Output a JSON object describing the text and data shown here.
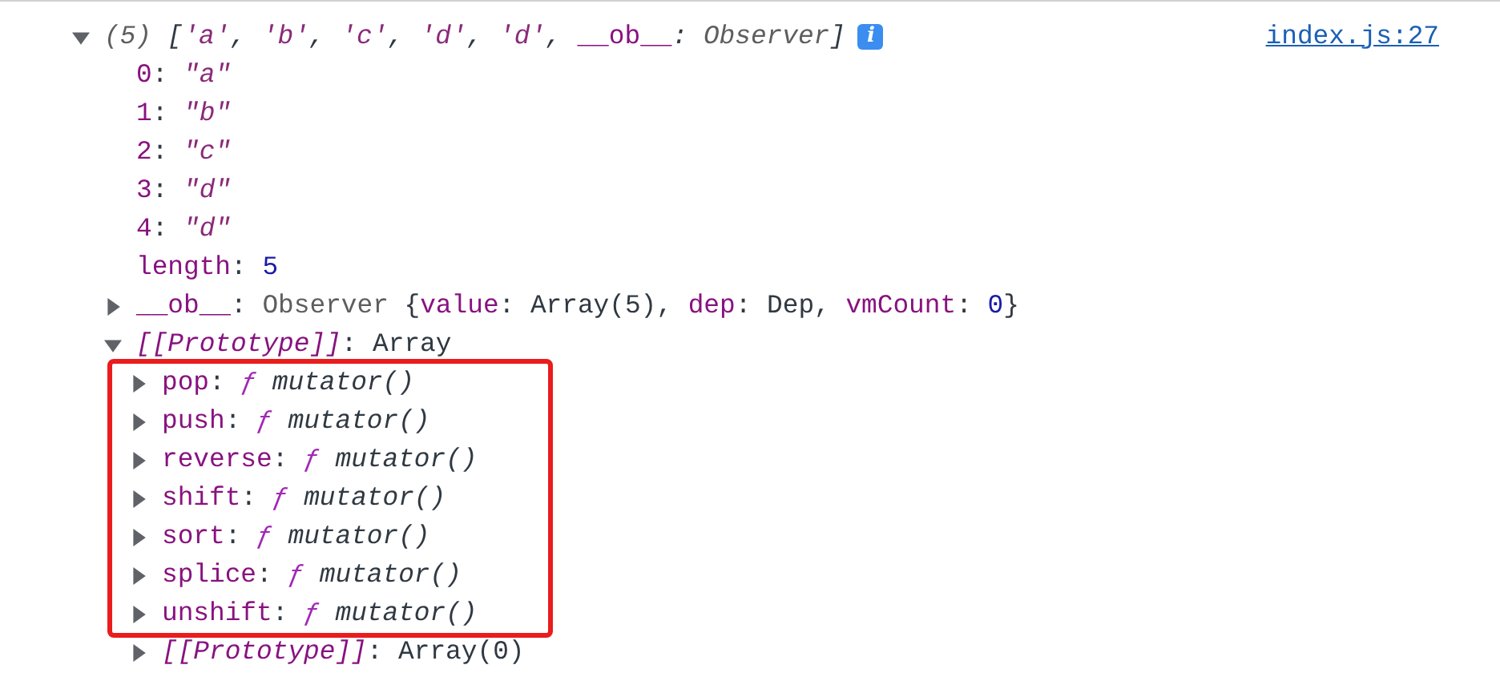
{
  "console": {
    "source_link": "index.js:27",
    "info_badge": "i",
    "summary": {
      "expanded": true,
      "tokens": [
        {
          "text": "(5) ",
          "kind": "meta"
        },
        {
          "text": "[",
          "kind": "punct"
        },
        {
          "text": "'a'",
          "kind": "string"
        },
        {
          "text": ", ",
          "kind": "punct"
        },
        {
          "text": "'b'",
          "kind": "string"
        },
        {
          "text": ", ",
          "kind": "punct"
        },
        {
          "text": "'c'",
          "kind": "string"
        },
        {
          "text": ", ",
          "kind": "punct"
        },
        {
          "text": "'d'",
          "kind": "string"
        },
        {
          "text": ", ",
          "kind": "punct"
        },
        {
          "text": "'d'",
          "kind": "string"
        },
        {
          "text": ", ",
          "kind": "punct"
        },
        {
          "text": "__ob__",
          "kind": "key"
        },
        {
          "text": ": ",
          "kind": "punct"
        },
        {
          "text": "Observer",
          "kind": "meta"
        },
        {
          "text": "]",
          "kind": "punct"
        }
      ]
    },
    "properties": [
      {
        "kind": "primitive",
        "tokens": [
          {
            "text": "0",
            "kind": "key"
          },
          {
            "text": ": ",
            "kind": "plain"
          },
          {
            "text": "\"a\"",
            "kind": "string"
          }
        ]
      },
      {
        "kind": "primitive",
        "tokens": [
          {
            "text": "1",
            "kind": "key"
          },
          {
            "text": ": ",
            "kind": "plain"
          },
          {
            "text": "\"b\"",
            "kind": "string"
          }
        ]
      },
      {
        "kind": "primitive",
        "tokens": [
          {
            "text": "2",
            "kind": "key"
          },
          {
            "text": ": ",
            "kind": "plain"
          },
          {
            "text": "\"c\"",
            "kind": "string"
          }
        ]
      },
      {
        "kind": "primitive",
        "tokens": [
          {
            "text": "3",
            "kind": "key"
          },
          {
            "text": ": ",
            "kind": "plain"
          },
          {
            "text": "\"d\"",
            "kind": "string"
          }
        ]
      },
      {
        "kind": "primitive",
        "tokens": [
          {
            "text": "4",
            "kind": "key"
          },
          {
            "text": ": ",
            "kind": "plain"
          },
          {
            "text": "\"d\"",
            "kind": "string"
          }
        ]
      },
      {
        "kind": "primitive",
        "tokens": [
          {
            "text": "length",
            "kind": "key"
          },
          {
            "text": ": ",
            "kind": "plain"
          },
          {
            "text": "5",
            "kind": "number"
          }
        ]
      },
      {
        "kind": "object",
        "expanded": false,
        "tokens": [
          {
            "text": "__ob__",
            "kind": "key"
          },
          {
            "text": ": ",
            "kind": "plain"
          },
          {
            "text": "Observer ",
            "kind": "class"
          },
          {
            "text": "{",
            "kind": "plain"
          },
          {
            "text": "value",
            "kind": "key"
          },
          {
            "text": ": Array(5), ",
            "kind": "plain"
          },
          {
            "text": "dep",
            "kind": "key"
          },
          {
            "text": ": Dep, ",
            "kind": "plain"
          },
          {
            "text": "vmCount",
            "kind": "key"
          },
          {
            "text": ": ",
            "kind": "plain"
          },
          {
            "text": "0",
            "kind": "number"
          },
          {
            "text": "}",
            "kind": "plain"
          }
        ]
      },
      {
        "kind": "object",
        "expanded": true,
        "tokens": [
          {
            "text": "[[Prototype]]",
            "kind": "internal-key"
          },
          {
            "text": ": Array",
            "kind": "plain"
          }
        ],
        "children": [
          {
            "kind": "object",
            "expanded": false,
            "highlighted": true,
            "tokens": [
              {
                "text": "pop",
                "kind": "key"
              },
              {
                "text": ": ",
                "kind": "plain"
              },
              {
                "text": "ƒ ",
                "kind": "function"
              },
              {
                "text": "mutator()",
                "kind": "function-name"
              }
            ]
          },
          {
            "kind": "object",
            "expanded": false,
            "highlighted": true,
            "tokens": [
              {
                "text": "push",
                "kind": "key"
              },
              {
                "text": ": ",
                "kind": "plain"
              },
              {
                "text": "ƒ ",
                "kind": "function"
              },
              {
                "text": "mutator()",
                "kind": "function-name"
              }
            ]
          },
          {
            "kind": "object",
            "expanded": false,
            "highlighted": true,
            "tokens": [
              {
                "text": "reverse",
                "kind": "key"
              },
              {
                "text": ": ",
                "kind": "plain"
              },
              {
                "text": "ƒ ",
                "kind": "function"
              },
              {
                "text": "mutator()",
                "kind": "function-name"
              }
            ]
          },
          {
            "kind": "object",
            "expanded": false,
            "highlighted": true,
            "tokens": [
              {
                "text": "shift",
                "kind": "key"
              },
              {
                "text": ": ",
                "kind": "plain"
              },
              {
                "text": "ƒ ",
                "kind": "function"
              },
              {
                "text": "mutator()",
                "kind": "function-name"
              }
            ]
          },
          {
            "kind": "object",
            "expanded": false,
            "highlighted": true,
            "tokens": [
              {
                "text": "sort",
                "kind": "key"
              },
              {
                "text": ": ",
                "kind": "plain"
              },
              {
                "text": "ƒ ",
                "kind": "function"
              },
              {
                "text": "mutator()",
                "kind": "function-name"
              }
            ]
          },
          {
            "kind": "object",
            "expanded": false,
            "highlighted": true,
            "tokens": [
              {
                "text": "splice",
                "kind": "key"
              },
              {
                "text": ": ",
                "kind": "plain"
              },
              {
                "text": "ƒ ",
                "kind": "function"
              },
              {
                "text": "mutator()",
                "kind": "function-name"
              }
            ]
          },
          {
            "kind": "object",
            "expanded": false,
            "highlighted": true,
            "tokens": [
              {
                "text": "unshift",
                "kind": "key"
              },
              {
                "text": ": ",
                "kind": "plain"
              },
              {
                "text": "ƒ ",
                "kind": "function"
              },
              {
                "text": "mutator()",
                "kind": "function-name"
              }
            ]
          },
          {
            "kind": "object",
            "expanded": false,
            "highlighted": false,
            "tokens": [
              {
                "text": "[[Prototype]]",
                "kind": "internal-key"
              },
              {
                "text": ": Array(0)",
                "kind": "plain"
              }
            ]
          }
        ]
      }
    ]
  }
}
